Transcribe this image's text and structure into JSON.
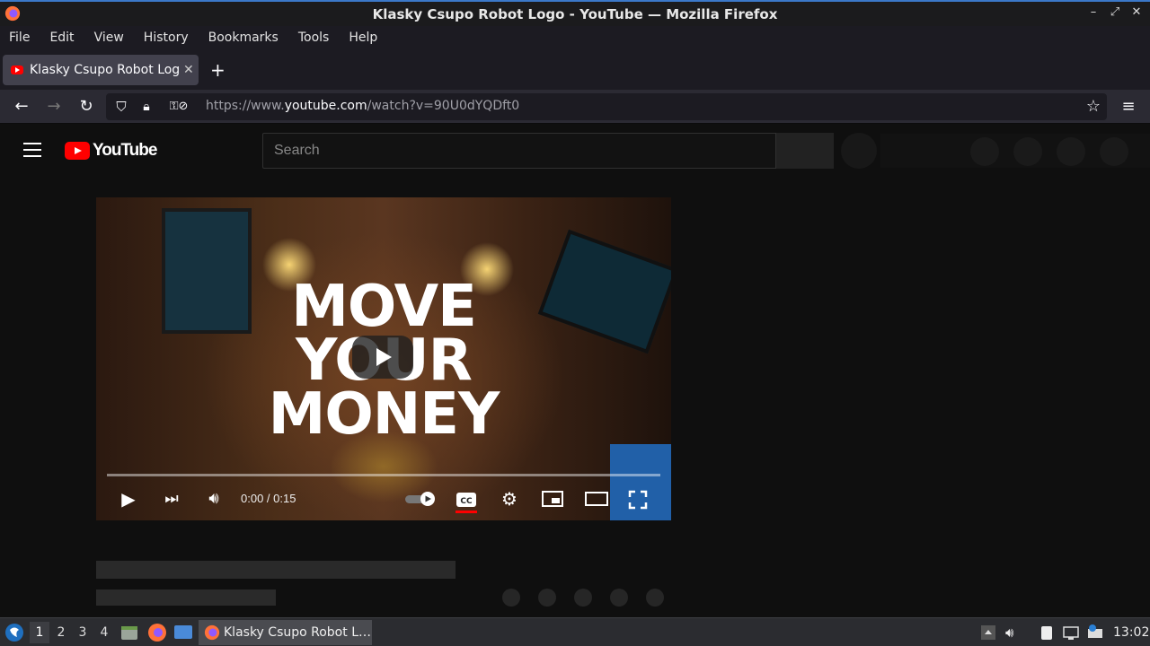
{
  "window": {
    "title": "Klasky Csupo Robot Logo - YouTube — Mozilla Firefox"
  },
  "menubar": {
    "items": [
      "File",
      "Edit",
      "View",
      "History",
      "Bookmarks",
      "Tools",
      "Help"
    ]
  },
  "tabs": [
    {
      "label": "Klasky Csupo Robot Logo"
    }
  ],
  "navbar": {
    "url_prefix": "https://www.",
    "url_domain": "youtube.com",
    "url_suffix": "/watch?v=90U0dYQDft0"
  },
  "youtube": {
    "logo_text": "YouTube",
    "search_placeholder": "Search"
  },
  "video": {
    "caption_lines": [
      "MOVE",
      "YOUR",
      "MONEY"
    ],
    "time_display": "0:00 / 0:15",
    "progress_fraction": 0
  },
  "taskbar": {
    "workspaces": [
      "1",
      "2",
      "3",
      "4"
    ],
    "active_workspace": "1",
    "task_label": "Klasky Csupo Robot L…",
    "clock": "13:02"
  },
  "colors": {
    "youtube_red": "#ff0000",
    "cc_underline": "#ff0000",
    "accent": "#3b78c9"
  }
}
